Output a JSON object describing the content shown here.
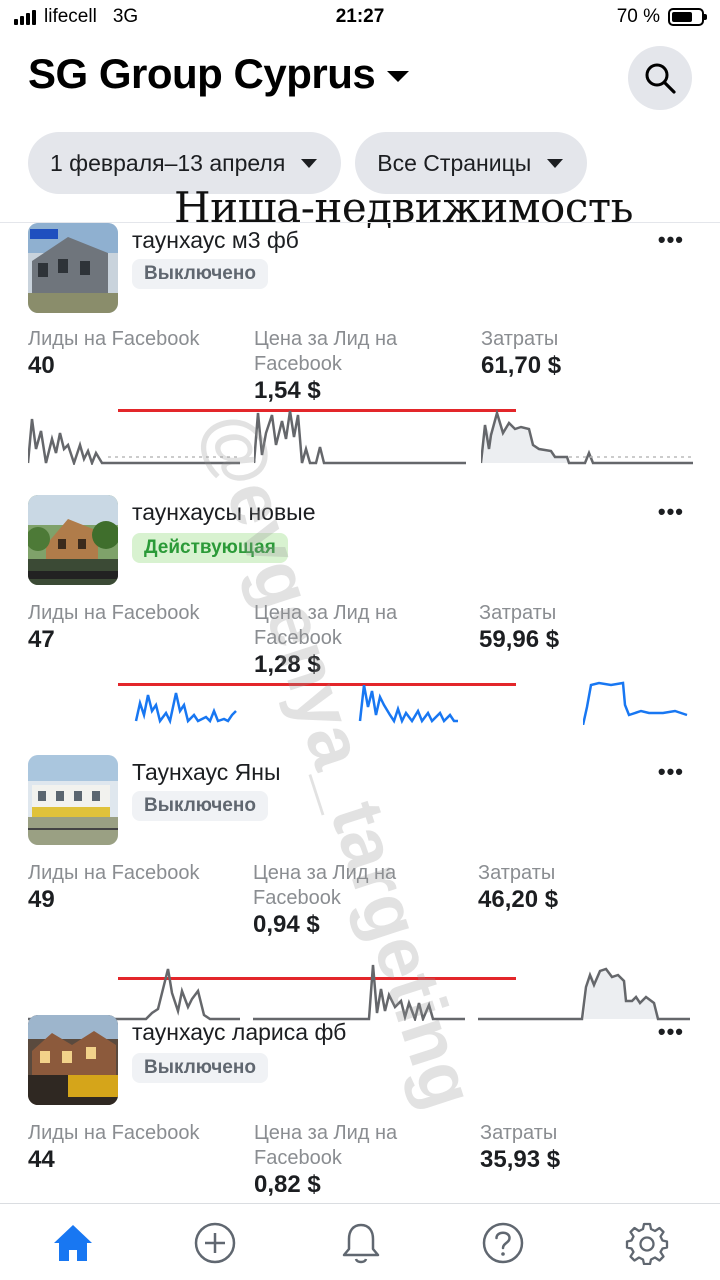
{
  "status_bar": {
    "carrier": "lifecell",
    "network": "3G",
    "time": "21:27",
    "battery": "70 %"
  },
  "header": {
    "title": "SG Group Cyprus",
    "search_icon": "search-icon"
  },
  "filters": {
    "date_range": "1 февраля–13 апреля",
    "pages": "Все Страницы"
  },
  "overlay_note": "Ниша-недвижимость",
  "watermark": "@evgenya_targeting",
  "labels": {
    "leads": "Лиды на Facebook",
    "cpl": "Цена за Лид на Facebook",
    "spend": "Затраты"
  },
  "colors": {
    "off_spark": "#65676b",
    "active_spark": "#1877f2",
    "red_underline": "#e3262a",
    "active_badge": "#2b9a38"
  },
  "campaigns": [
    {
      "name": "таунхаус м3 фб",
      "status": "Выключено",
      "active": false,
      "leads": "40",
      "cpl": "1,54 $",
      "spend": "61,70 $"
    },
    {
      "name": "таунхаусы новые",
      "status": "Действующая",
      "active": true,
      "leads": "47",
      "cpl": "1,28 $",
      "spend": "59,96 $"
    },
    {
      "name": "Таунхаус Яны",
      "status": "Выключено",
      "active": false,
      "leads": "49",
      "cpl": "0,94 $",
      "spend": "46,20 $"
    },
    {
      "name": "таунхаус лариса фб",
      "status": "Выключено",
      "active": false,
      "leads": "44",
      "cpl": "0,82 $",
      "spend": "35,93 $"
    }
  ],
  "tabbar": [
    "home-icon",
    "add-icon",
    "bell-icon",
    "help-icon",
    "gear-icon"
  ]
}
